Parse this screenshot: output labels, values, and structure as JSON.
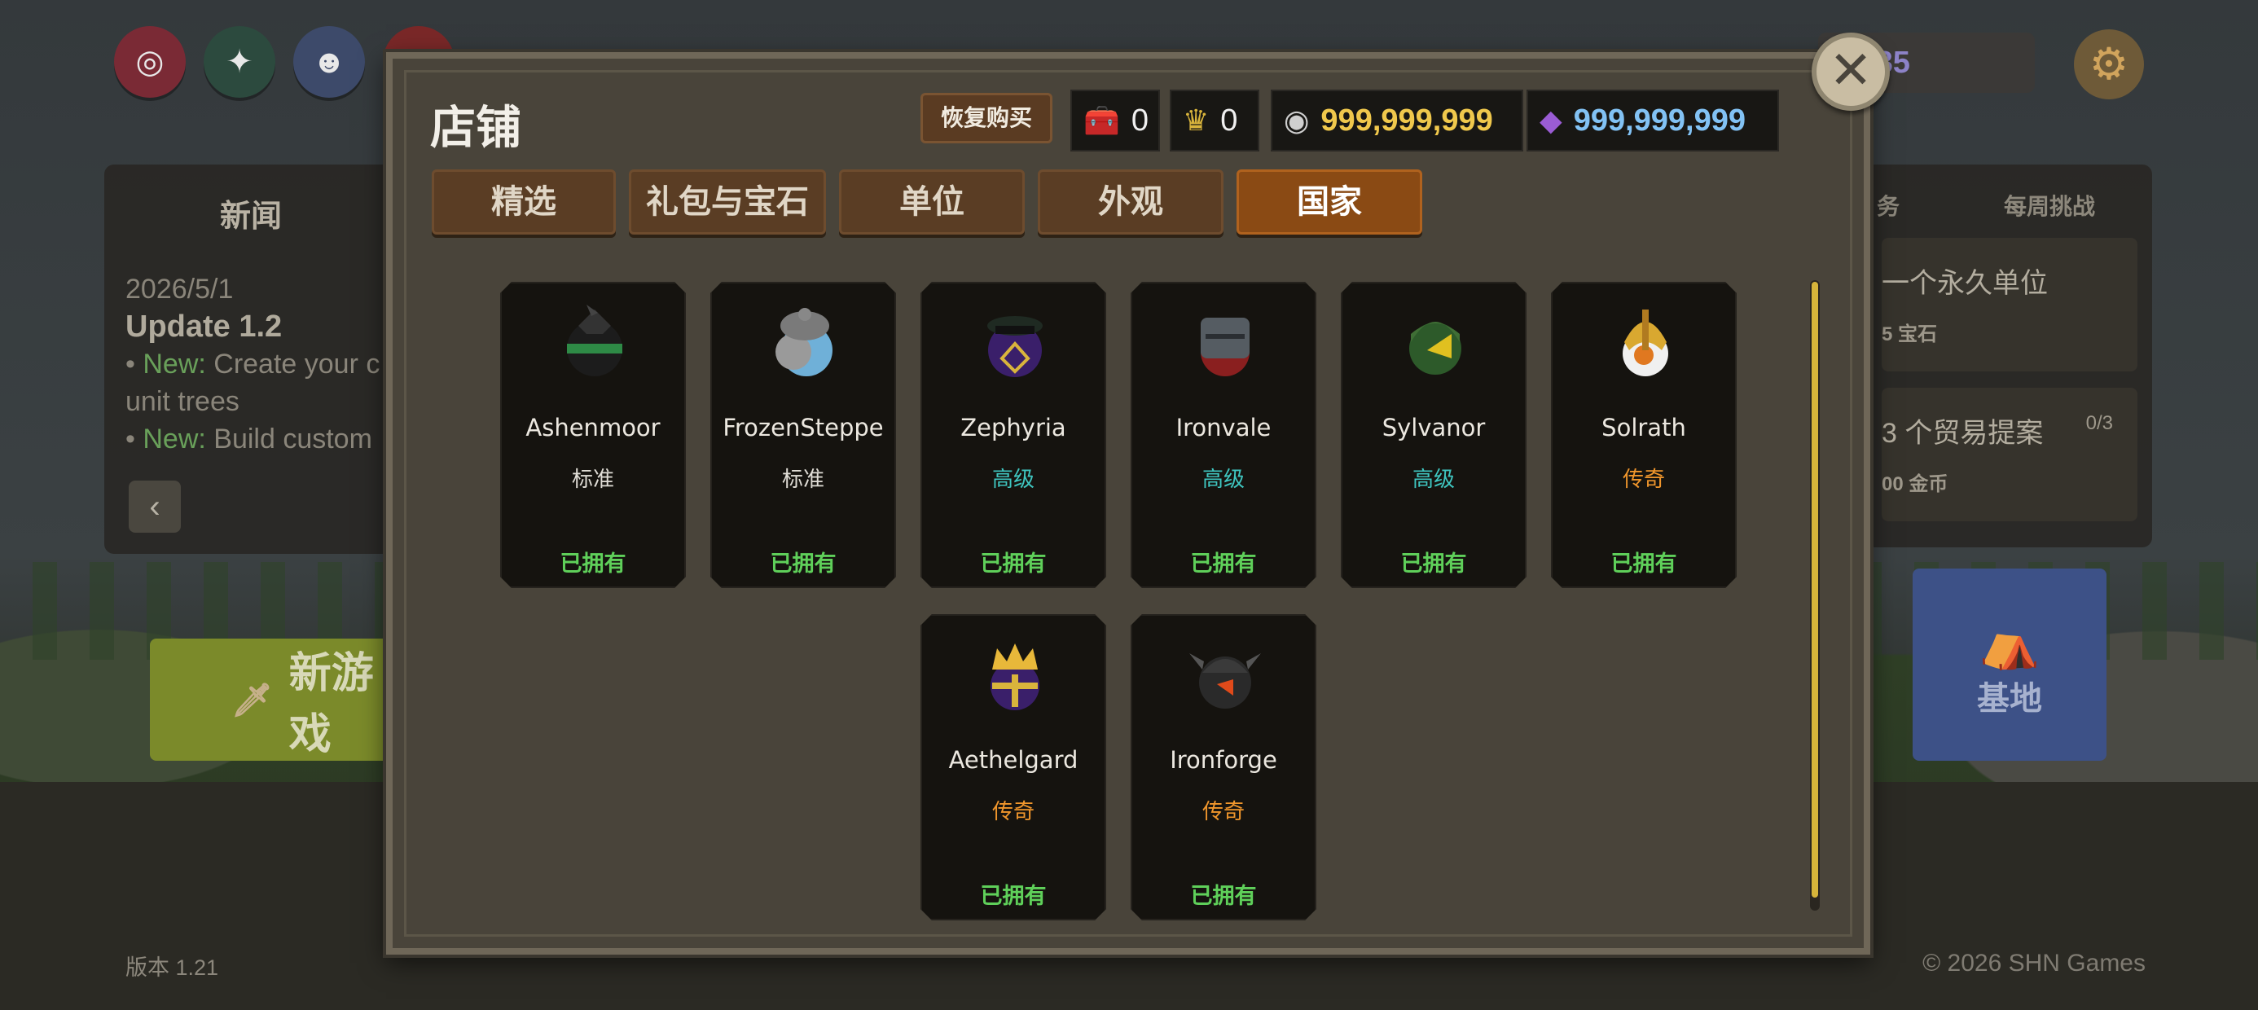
{
  "background": {
    "social": [
      "instagram-icon",
      "twitter-icon",
      "discord-icon",
      "youtube-icon"
    ],
    "news": {
      "title": "新闻",
      "date": "2026/5/1",
      "update": "Update 1.2",
      "line1_tag": "New:",
      "line1_text": " Create your c",
      "line1_cont": "unit trees",
      "line2_tag": "New:",
      "line2_text": " Build custom",
      "prev": "‹"
    },
    "new_game": "新游戏",
    "tasks": {
      "tab_daily": "务",
      "tab_weekly": "每周挑战",
      "task1_text": "一个永久单位",
      "task1_reward": "5 宝石",
      "task2_text": "3 个贸易提案",
      "task2_progress": "0/3",
      "task2_reward": "00 金币"
    },
    "base": "基地",
    "level": "/85",
    "version": "版本 1.21",
    "copyright": "© 2026 SHN Games"
  },
  "shop": {
    "title": "店铺",
    "restore": "恢复购买",
    "currencies": {
      "chest": "0",
      "crown": "0",
      "silver": "999,999,999",
      "gems": "999,999,999"
    },
    "tabs": [
      {
        "label": "精选"
      },
      {
        "label": "礼包与宝石"
      },
      {
        "label": "单位"
      },
      {
        "label": "外观"
      },
      {
        "label": "国家"
      }
    ],
    "active_tab": "国家",
    "nations": [
      {
        "name": "Ashenmoor",
        "tier": "标准",
        "tier_color": "#e0ddd6",
        "status": "已拥有",
        "icon": "dark-bird-helmet-icon"
      },
      {
        "name": "FrozenSteppe",
        "tier": "标准",
        "tier_color": "#e0ddd6",
        "status": "已拥有",
        "icon": "fur-hat-ball-icon"
      },
      {
        "name": "Zephyria",
        "tier": "高级",
        "tier_color": "#3fc6c0",
        "status": "已拥有",
        "icon": "officer-cap-ball-icon"
      },
      {
        "name": "Ironvale",
        "tier": "高级",
        "tier_color": "#3fc6c0",
        "status": "已拥有",
        "icon": "iron-helmet-ball-icon"
      },
      {
        "name": "Sylvanor",
        "tier": "高级",
        "tier_color": "#3fc6c0",
        "status": "已拥有",
        "icon": "green-hood-ball-icon"
      },
      {
        "name": "Solrath",
        "tier": "传奇",
        "tier_color": "#f0962c",
        "status": "已拥有",
        "icon": "golden-helm-ball-icon"
      },
      {
        "name": "Aethelgard",
        "tier": "传奇",
        "tier_color": "#f0962c",
        "status": "已拥有",
        "icon": "crown-ball-icon"
      },
      {
        "name": "Ironforge",
        "tier": "传奇",
        "tier_color": "#f0962c",
        "status": "已拥有",
        "icon": "horned-helmet-ball-icon"
      }
    ],
    "close": "✕"
  }
}
